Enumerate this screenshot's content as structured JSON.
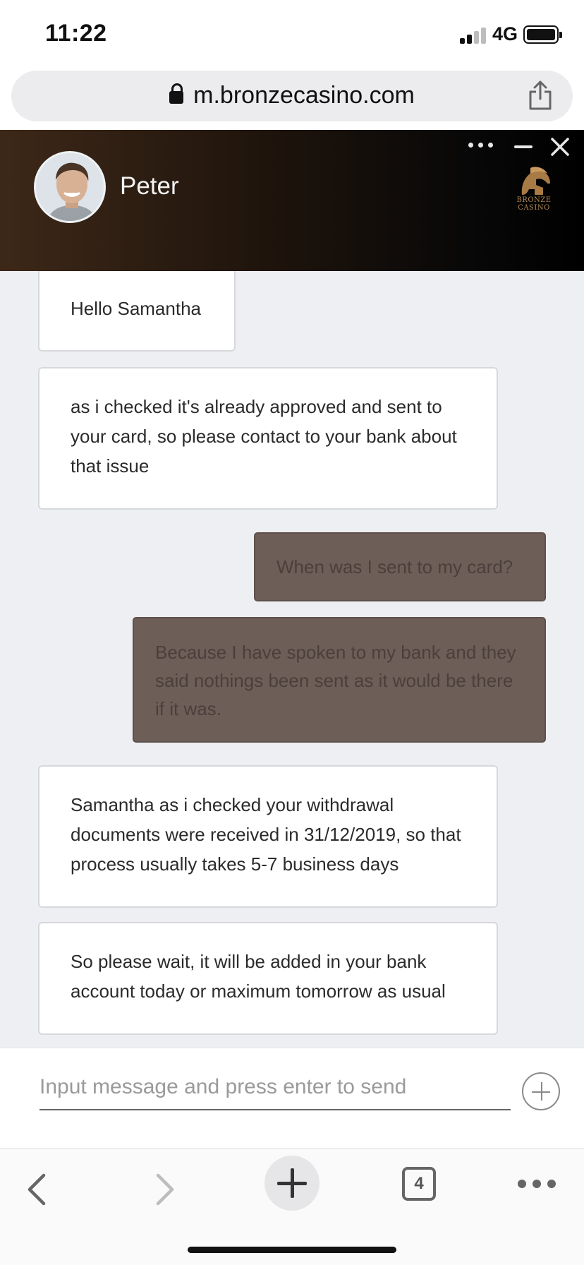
{
  "status_bar": {
    "time": "11:22",
    "network": "4G"
  },
  "browser": {
    "url": "m.bronzecasino.com",
    "tab_count": "4"
  },
  "chat_header": {
    "agent_name": "Peter",
    "logo_text_line1": "BRONZE",
    "logo_text_line2": "CASINO",
    "header_color_start": "#3d2818",
    "header_color_end": "#000000"
  },
  "messages": [
    {
      "sender": "agent",
      "text": "Hello Samantha"
    },
    {
      "sender": "agent",
      "text": "as i checked it's already approved and sent to your card, so please contact to your bank about that issue"
    },
    {
      "sender": "user",
      "text": "When was I sent to my card?"
    },
    {
      "sender": "user",
      "text": "Because I have spoken to my bank and they said nothings been sent as it would be there if it was."
    },
    {
      "sender": "agent",
      "text": "Samantha as i checked your withdrawal documents were received in 31/12/2019, so that process usually takes 5-7 business days"
    },
    {
      "sender": "agent",
      "text": "So please wait, it will be added in your bank account today or maximum tomorrow as usual"
    }
  ],
  "composer": {
    "placeholder": "Input message and press enter to send",
    "value": ""
  },
  "colors": {
    "user_bubble": "#6e5e58",
    "agent_bubble": "#ffffff",
    "chat_background": "#eeeff2"
  }
}
